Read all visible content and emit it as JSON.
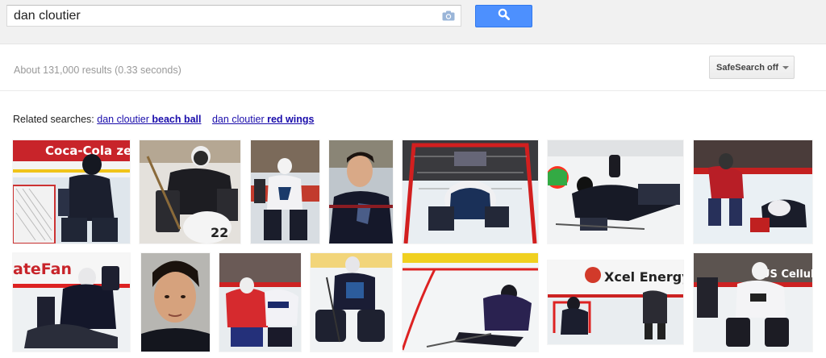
{
  "search": {
    "query": "dan cloutier",
    "camera_icon": "camera-icon",
    "button_icon": "search-icon"
  },
  "stats": {
    "text": "About 131,000 results (0.33 seconds)"
  },
  "safesearch": {
    "label": "SafeSearch off"
  },
  "related": {
    "prefix": "Related searches:",
    "items": [
      {
        "plain": "dan cloutier ",
        "bold": "beach ball"
      },
      {
        "plain": "dan cloutier ",
        "bold": "red wings"
      }
    ]
  },
  "thumb_text": {
    "t1": "Coca-Cola zero",
    "t2": "ateFan",
    "t3": "Xcel Energy",
    "t4": "US Cellular"
  },
  "colors": {
    "accent": "#4d90fe",
    "link": "#1a0dab",
    "toolbar_bg": "#f1f1f1"
  }
}
